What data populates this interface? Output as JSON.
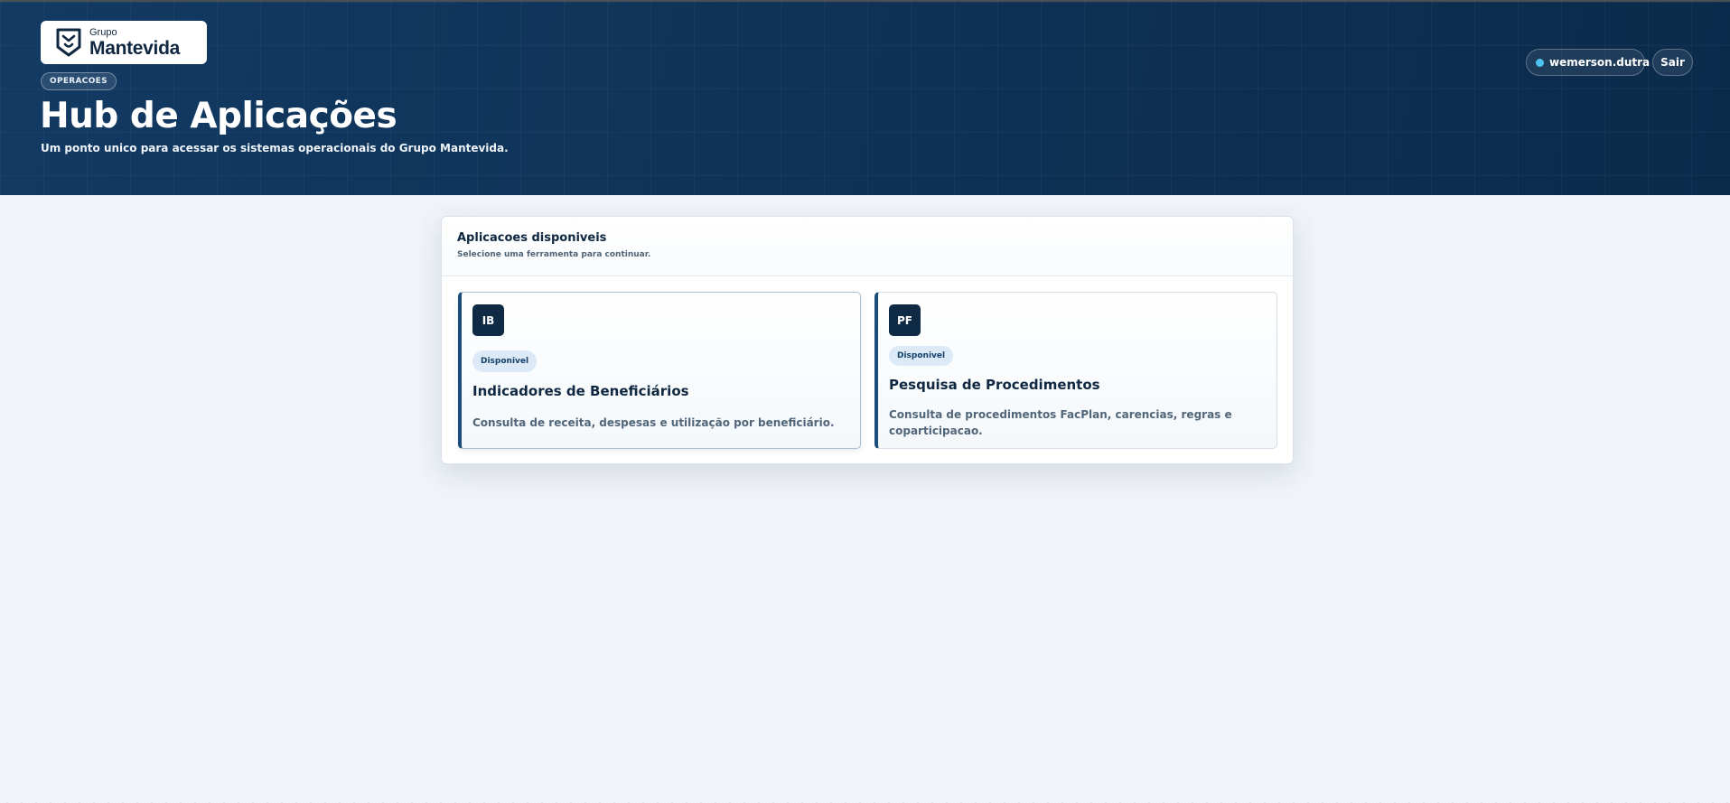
{
  "header": {
    "logo": {
      "small": "Grupo",
      "big": "Mantevida"
    },
    "section_tag": "OPERACOES",
    "title": "Hub de Aplicações",
    "subtitle": "Um ponto unico para acessar os sistemas operacionais do Grupo Mantevida.",
    "user": {
      "name": "wemerson.dutra",
      "status_color": "#4cc3f0"
    },
    "logout_label": "Sair"
  },
  "panel": {
    "title": "Aplicacoes disponiveis",
    "subtitle": "Selecione uma ferramenta para continuar.",
    "apps": [
      {
        "abbr": "IB",
        "status": "Disponivel",
        "title": "Indicadores de Beneficiários",
        "description": "Consulta de receita, despesas e utilização por beneficiário."
      },
      {
        "abbr": "PF",
        "status": "Disponivel",
        "title": "Pesquisa de Procedimentos",
        "description": "Consulta de procedimentos FacPlan, carencias, regras e coparticipacao."
      }
    ]
  },
  "colors": {
    "hero_dark": "#0c2b4b",
    "hero_light": "#123a63",
    "accent": "#1c4d7a",
    "badge_bg": "#dbeaf6"
  }
}
